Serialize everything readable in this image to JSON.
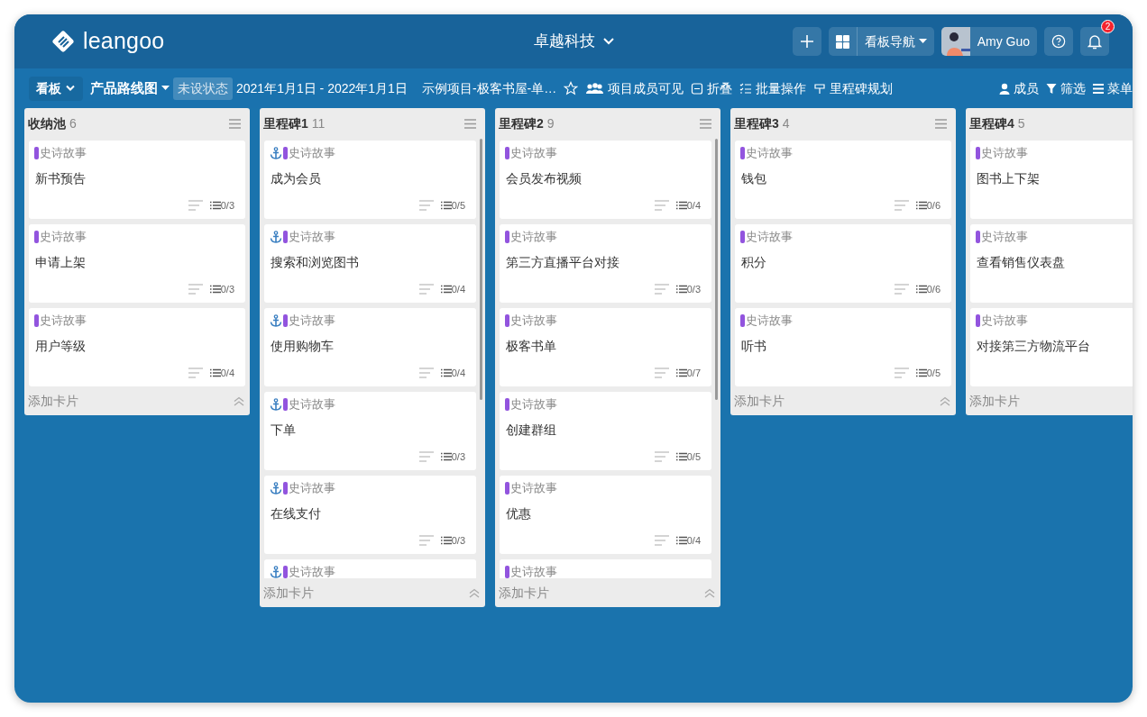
{
  "header": {
    "logo": "leangoo",
    "workspace": "卓越科技",
    "board_nav": "看板导航",
    "user": "Amy Guo",
    "notifications": "2"
  },
  "toolbar": {
    "left": [
      {
        "kind": "dropdown",
        "label": "看板"
      },
      {
        "kind": "title",
        "label": "产品路线图"
      },
      {
        "kind": "status",
        "label": "未设状态"
      },
      {
        "kind": "text",
        "label": "2021年1月1日 - 2022年1月1日"
      },
      {
        "kind": "text",
        "label": "示例项目-极客书屋-单…"
      },
      {
        "kind": "star"
      },
      {
        "kind": "action",
        "label": "项目成员可见"
      },
      {
        "kind": "action",
        "label": "折叠"
      },
      {
        "kind": "action",
        "label": "批量操作"
      },
      {
        "kind": "action",
        "label": "里程碑规划"
      }
    ],
    "right": [
      {
        "label": "成员"
      },
      {
        "label": "筛选"
      },
      {
        "label": "菜单"
      }
    ]
  },
  "columns": [
    {
      "title": "收纳池",
      "count": "6",
      "scrollable": false,
      "menu": true,
      "collapse": true,
      "add_label": "添加卡片",
      "cards": [
        {
          "anchored": false,
          "label": "史诗故事",
          "title": "新书预告",
          "checklist": "0/3"
        },
        {
          "anchored": false,
          "label": "史诗故事",
          "title": "申请上架",
          "checklist": "0/3"
        },
        {
          "anchored": false,
          "label": "史诗故事",
          "title": "用户等级",
          "checklist": "0/4"
        }
      ]
    },
    {
      "title": "里程碑1",
      "count": "11",
      "scrollable": true,
      "menu": true,
      "collapse": true,
      "add_label": "添加卡片",
      "cards": [
        {
          "anchored": true,
          "label": "史诗故事",
          "title": "成为会员",
          "checklist": "0/5"
        },
        {
          "anchored": true,
          "label": "史诗故事",
          "title": "搜索和浏览图书",
          "checklist": "0/4"
        },
        {
          "anchored": true,
          "label": "史诗故事",
          "title": "使用购物车",
          "checklist": "0/4"
        },
        {
          "anchored": true,
          "label": "史诗故事",
          "title": "下单",
          "checklist": "0/3"
        },
        {
          "anchored": true,
          "label": "史诗故事",
          "title": "在线支付",
          "checklist": "0/3"
        },
        {
          "anchored": true,
          "label": "史诗故事"
        }
      ]
    },
    {
      "title": "里程碑2",
      "count": "9",
      "scrollable": true,
      "menu": true,
      "collapse": true,
      "add_label": "添加卡片",
      "cards": [
        {
          "anchored": false,
          "label": "史诗故事",
          "title": "会员发布视频",
          "checklist": "0/4"
        },
        {
          "anchored": false,
          "label": "史诗故事",
          "title": "第三方直播平台对接",
          "checklist": "0/3"
        },
        {
          "anchored": false,
          "label": "史诗故事",
          "title": "极客书单",
          "checklist": "0/7"
        },
        {
          "anchored": false,
          "label": "史诗故事",
          "title": "创建群组",
          "checklist": "0/5"
        },
        {
          "anchored": false,
          "label": "史诗故事",
          "title": "优惠",
          "checklist": "0/4"
        },
        {
          "anchored": false,
          "label": "史诗故事"
        }
      ]
    },
    {
      "title": "里程碑3",
      "count": "4",
      "scrollable": false,
      "menu": true,
      "collapse": true,
      "add_label": "添加卡片",
      "cards": [
        {
          "anchored": false,
          "label": "史诗故事",
          "title": "钱包",
          "checklist": "0/6"
        },
        {
          "anchored": false,
          "label": "史诗故事",
          "title": "积分",
          "checklist": "0/6"
        },
        {
          "anchored": false,
          "label": "史诗故事",
          "title": "听书",
          "checklist": "0/5"
        }
      ]
    },
    {
      "title": "里程碑4",
      "count": "5",
      "scrollable": false,
      "menu": false,
      "collapse": false,
      "add_label": "添加卡片",
      "cards": [
        {
          "anchored": false,
          "label": "史诗故事",
          "title": "图书上下架"
        },
        {
          "anchored": false,
          "label": "史诗故事",
          "title": "查看销售仪表盘"
        },
        {
          "anchored": false,
          "label": "史诗故事",
          "title": "对接第三方物流平台"
        }
      ]
    }
  ]
}
